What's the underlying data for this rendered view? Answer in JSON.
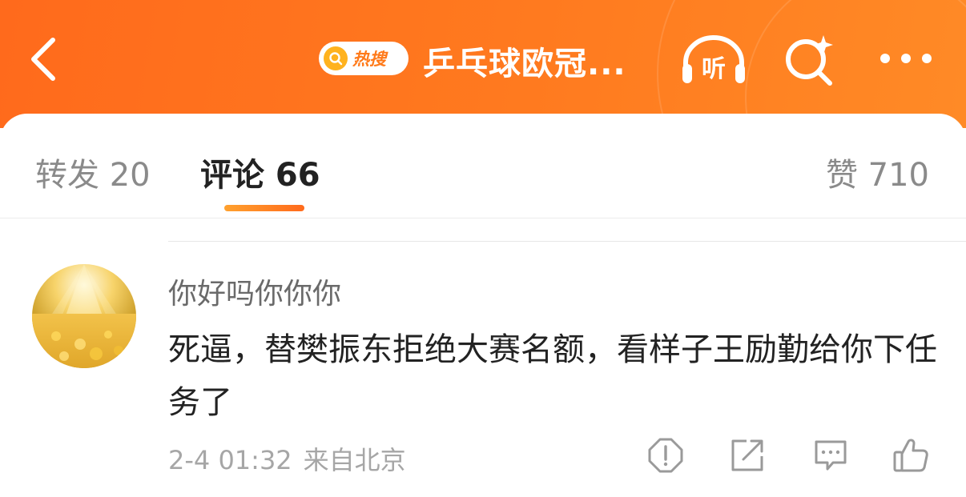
{
  "header": {
    "hot_badge": "热搜",
    "title": "乒乓球欧冠...",
    "listen_label": "听",
    "colors": {
      "brand": "#ff7a1f",
      "hot_badge": "#ffb21e"
    },
    "icons": [
      "back-icon",
      "search-icon",
      "headphones-icon",
      "sparkle-search-icon",
      "more-icon"
    ]
  },
  "tabs": {
    "repost": "转发 20",
    "comment": "评论 66",
    "like": "赞 710",
    "active": "comment"
  },
  "comment": {
    "username": "你好吗你你你",
    "text": "死逼，替樊振东拒绝大赛名额，看样子王励勤给你下任务了",
    "time": "2-4 01:32",
    "location": "来自北京",
    "actions": [
      "report-icon",
      "share-icon",
      "reply-icon",
      "like-icon"
    ]
  }
}
